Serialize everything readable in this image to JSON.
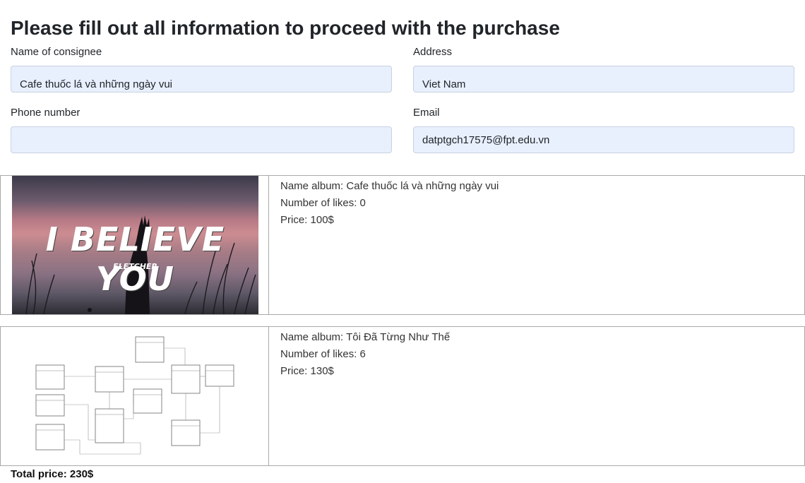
{
  "page": {
    "title": "Please fill out all information to proceed with the purchase"
  },
  "form": {
    "consignee": {
      "label": "Name of consignee",
      "value": "Cafe thuốc lá và những ngày vui"
    },
    "address": {
      "label": "Address",
      "value": "Viet Nam"
    },
    "phone": {
      "label": "Phone number",
      "value": ""
    },
    "email": {
      "label": "Email",
      "value": "datptgch17575@fpt.edu.vn"
    }
  },
  "albums": [
    {
      "name_line": "Name album: Cafe thuốc lá và những ngày vui",
      "likes_line": "Number of likes: 0",
      "price_line": "Price: 100$",
      "artwork_text": "I BELIEVE YOU",
      "artwork_subtext": "FLETCHER"
    },
    {
      "name_line": "Name album: Tôi Đã Từng Như Thế",
      "likes_line": "Number of likes: 6",
      "price_line": "Price: 130$"
    }
  ],
  "summary": {
    "total_line": "Total price: 230$"
  }
}
